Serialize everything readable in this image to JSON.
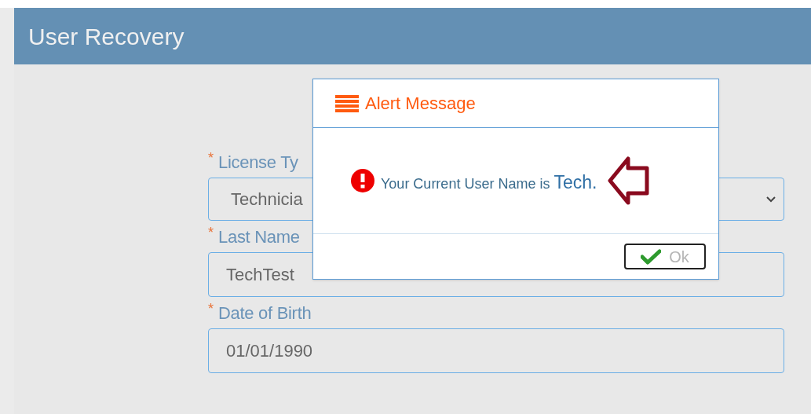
{
  "panel": {
    "title": "User Recovery"
  },
  "form": {
    "fields": [
      {
        "kind": "select",
        "required_mark": "*",
        "label": "License Ty",
        "value": "Technicia"
      },
      {
        "kind": "text",
        "required_mark": "*",
        "label": "Last Name",
        "value": "TechTest"
      },
      {
        "kind": "text",
        "required_mark": "*",
        "label": "Date of Birth",
        "value": "01/01/1990"
      }
    ]
  },
  "dialog": {
    "title": "Alert Message",
    "message": "Your Current User Name is",
    "username": "Tech.",
    "ok_button": {
      "label": "Ok",
      "disabled": true
    }
  }
}
